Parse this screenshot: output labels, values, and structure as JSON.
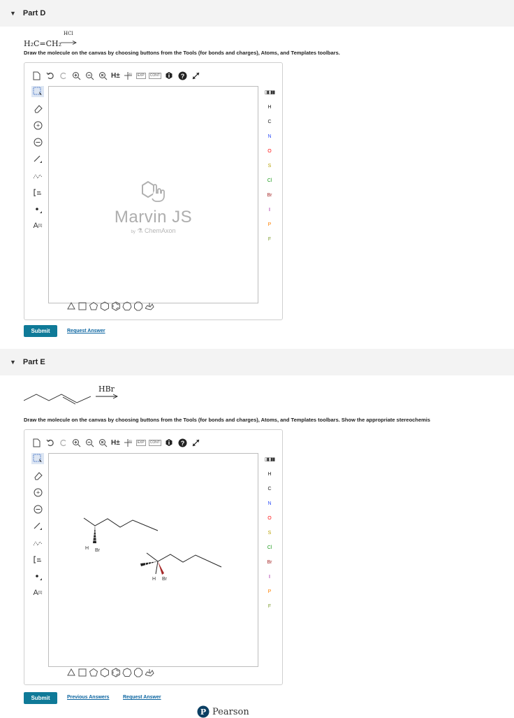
{
  "part_d": {
    "title": "Part D",
    "reactant": "H₂C=CH₂",
    "reagent": "HCl",
    "instruction": "Draw the molecule on the canvas by choosing buttons from the Tools (for bonds and charges), Atoms, and Templates toolbars.",
    "submit_label": "Submit",
    "request_answer_label": "Request Answer"
  },
  "part_e": {
    "title": "Part E",
    "reagent": "HBr",
    "instruction": "Draw the molecule on the canvas by choosing buttons from the Tools (for bonds and charges), Atoms, and Templates toolbars. Show the appropriate stereochemis",
    "submit_label": "Submit",
    "previous_answers_label": "Previous Answers",
    "request_answer_label": "Request Answer",
    "molecule_labels": {
      "h1": "H",
      "br1": "Br",
      "h2": "H",
      "br2": "Br"
    }
  },
  "editor": {
    "toolbar_top": {
      "h_label": "H±",
      "exp_label": "EXP",
      "cont_label": "CONT"
    },
    "left_tools": {
      "charge_plus": "+",
      "charge_minus": "−",
      "text_tool": "A",
      "text_superscript": "[1]"
    },
    "atoms": [
      "H",
      "C",
      "N",
      "O",
      "S",
      "Cl",
      "Br",
      "I",
      "P",
      "F"
    ],
    "atom_colors": {
      "H": "#333333",
      "C": "#333333",
      "N": "#3050f8",
      "O": "#ff0d0d",
      "S": "#b8a000",
      "Cl": "#1f9c1f",
      "Br": "#a62929",
      "I": "#940094",
      "P": "#ff8000",
      "F": "#7a9a2a"
    },
    "watermark_title": "Marvin JS",
    "watermark_by": "by",
    "watermark_company": "ChemAxon"
  },
  "footer": {
    "brand": "Pearson"
  },
  "colors": {
    "accent": "#0f7a98",
    "link": "#0a64a0"
  }
}
